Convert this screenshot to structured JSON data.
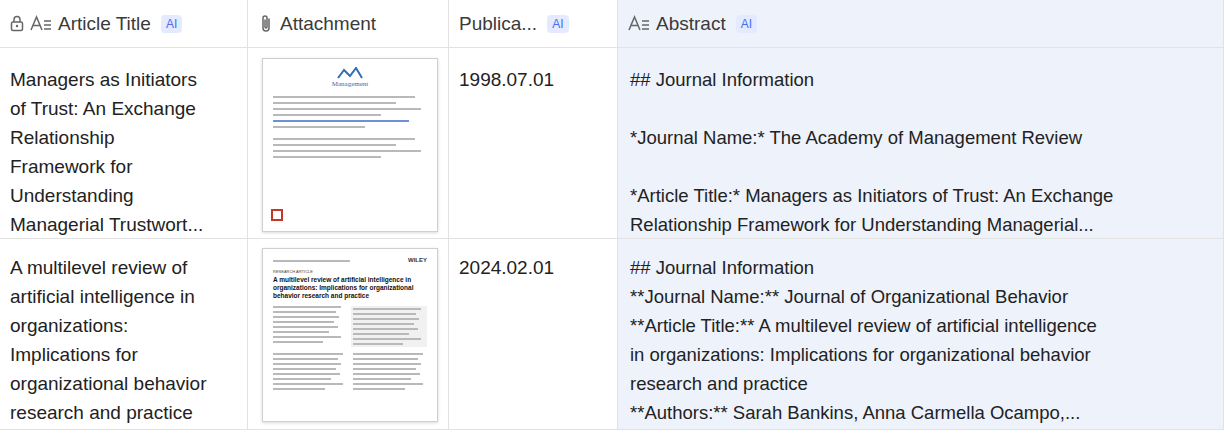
{
  "table": {
    "columns": [
      {
        "label": "Article Title",
        "icon": "text",
        "locked": true,
        "badge": "AI",
        "selected": false
      },
      {
        "label": "Attachment",
        "icon": "attachment",
        "locked": false,
        "badge": "",
        "selected": false
      },
      {
        "label": "Publica...",
        "icon": "none",
        "locked": false,
        "badge": "AI",
        "selected": false
      },
      {
        "label": "Abstract",
        "icon": "text",
        "locked": false,
        "badge": "AI",
        "selected": true
      }
    ],
    "rows": [
      {
        "title_lines": [
          "Managers as Initiators",
          "of Trust: An Exchange",
          "Relationship",
          "Framework for",
          "Understanding",
          "Managerial Trustwort..."
        ],
        "attachment": {
          "kind": "aom",
          "logo": "Management"
        },
        "date": "1998.07.01",
        "abstract_lines": [
          "## Journal Information",
          "",
          "*Journal Name:* The Academy of Management Review",
          "",
          "*Article Title:* Managers as Initiators of Trust: An Exchange",
          "Relationship Framework for Understanding Managerial..."
        ]
      },
      {
        "title_lines": [
          "A multilevel review of",
          "artificial intelligence in",
          "organizations:",
          "Implications for",
          "organizational behavior",
          "research and practice"
        ],
        "attachment": {
          "kind": "wiley",
          "publisher": "WILEY",
          "section": "RESEARCH ARTICLE",
          "title": "A multilevel review of artificial intelligence in organizations: Implications for organizational behavior research and practice"
        },
        "date": "2024.02.01",
        "abstract_lines": [
          "## Journal Information",
          "**Journal Name:** Journal of Organizational Behavior",
          "**Article Title:** A multilevel review of artificial intelligence",
          "in organizations: Implications for organizational behavior",
          "research and practice",
          "**Authors:** Sarah Bankins, Anna Carmella Ocampo,..."
        ]
      }
    ]
  }
}
